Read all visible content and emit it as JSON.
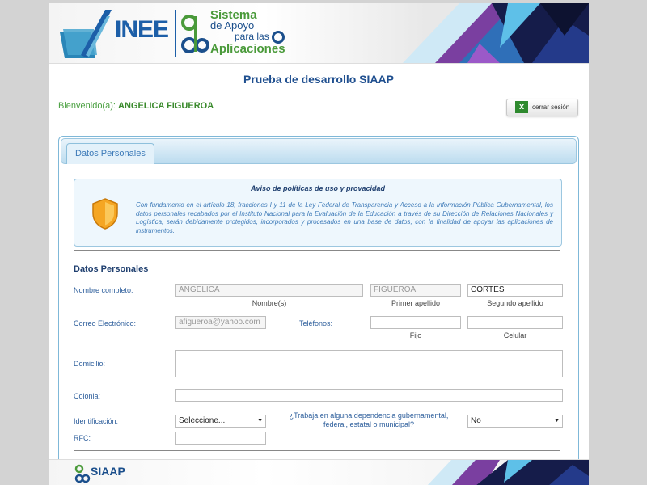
{
  "header": {
    "inee_logo_text": "INEE",
    "siaap_line1": "Sistema",
    "siaap_line2": "de Apoyo",
    "siaap_line3": "para las",
    "siaap_line4": "Aplicaciones"
  },
  "page_title": "Prueba de desarrollo SIAAP",
  "welcome": {
    "label": "Bienvenido(a):",
    "user": "ANGELICA FIGUEROA"
  },
  "logout_label": "cerrar sesión",
  "tabs": [
    {
      "label": "Datos Personales",
      "active": true
    }
  ],
  "notice": {
    "title": "Aviso de políticas de uso y provacidad",
    "body": "Con fundamento en el artículo 18, fracciones I y 11 de la Ley Federal de Transparencia y Acceso a la Información Pública Gubernamental, los datos personales recabados por el Instituto Nacional para la Evaluación de la Educación a través de su Dirección de Relaciones Nacionales y Logística, serán debidamente protegidos, incorporados y procesados en una base de datos, con la finalidad de apoyar las aplicaciones de instrumentos."
  },
  "form": {
    "section_title": "Datos Personales",
    "nombre_label": "Nombre completo:",
    "nombre_value": "ANGELICA",
    "nombre_sub": "Nombre(s)",
    "apellido1_value": "FIGUEROA",
    "apellido1_sub": "Primer apellido",
    "apellido2_value": "CORTES",
    "apellido2_sub": "Segundo apellido",
    "correo_label": "Correo Electrónico:",
    "correo_value": "afigueroa@yahoo.com",
    "telefonos_label": "Teléfonos:",
    "fijo_sub": "Fijo",
    "celular_sub": "Celular",
    "domicilio_label": "Domicilio:",
    "colonia_label": "Colonia:",
    "identificacion_label": "Identificación:",
    "identificacion_value": "Seleccione...",
    "question": "¿Trabaja en alguna dependencia gubernamental, federal, estatal o municipal?",
    "question_value": "No",
    "rfc_label": "RFC:"
  },
  "footer": {
    "logo_text": "SIAAP"
  },
  "colors": {
    "brand_blue": "#1d5fa8",
    "brand_green": "#4a9a3a",
    "tab_blue": "#3d7ab8"
  }
}
